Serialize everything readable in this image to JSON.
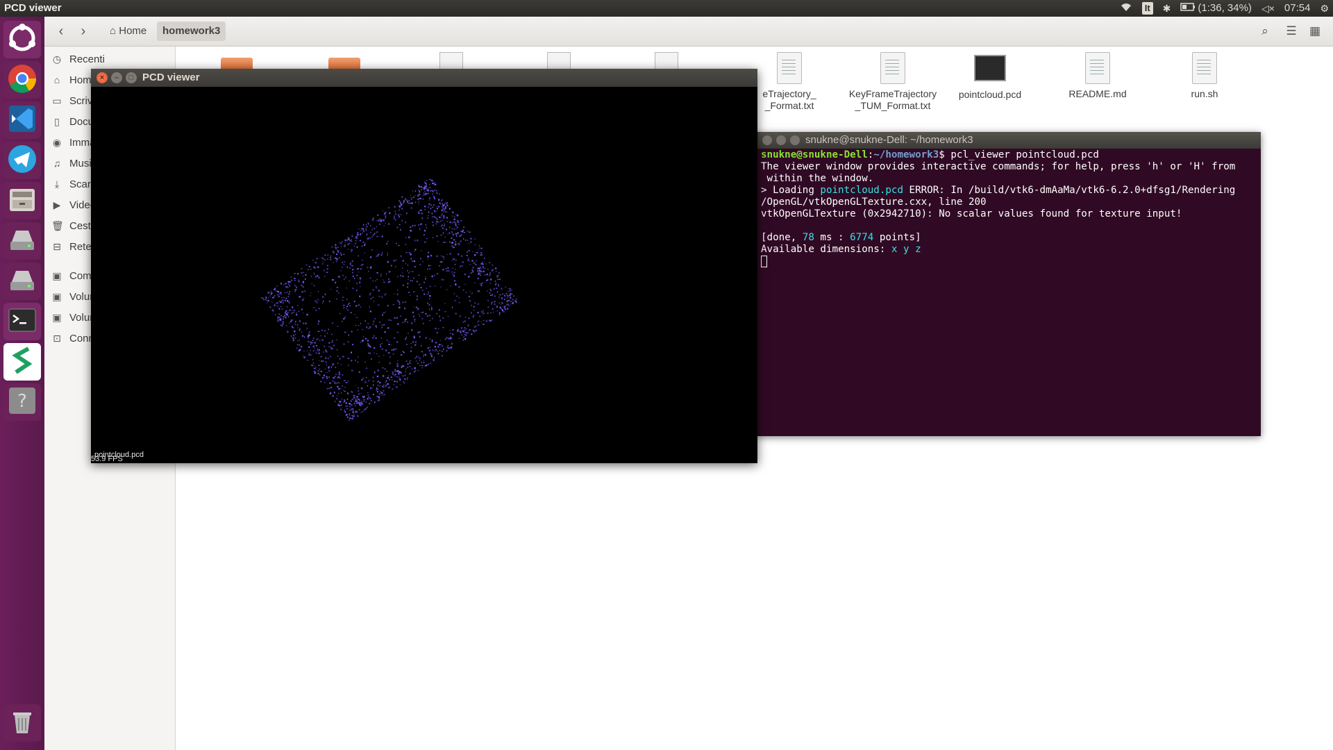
{
  "top_panel": {
    "app_title": "PCD viewer",
    "keyboard_layout": "It",
    "battery": "(1:36, 34%)",
    "clock": "07:54"
  },
  "launcher": {
    "items": [
      "ubuntu-dash",
      "chrome",
      "vscode",
      "telegram",
      "file-manager",
      "disk-drive",
      "disk-drive-2",
      "terminal",
      "app-s",
      "help",
      "trash"
    ]
  },
  "file_manager": {
    "breadcrumb": {
      "home": "Home",
      "current": "homework3"
    },
    "sidebar": [
      {
        "label": "Recenti",
        "icon": "clock-icon"
      },
      {
        "label": "Home",
        "icon": "home-icon"
      },
      {
        "label": "Scrivania",
        "icon": "folder-icon"
      },
      {
        "label": "Documenti",
        "icon": "document-icon"
      },
      {
        "label": "Immagini",
        "icon": "camera-icon"
      },
      {
        "label": "Musica",
        "icon": "music-icon"
      },
      {
        "label": "Scaricati",
        "icon": "download-icon"
      },
      {
        "label": "Video",
        "icon": "video-icon"
      },
      {
        "label": "Cestino",
        "icon": "trash-icon"
      },
      {
        "label": "Rete",
        "icon": "network-icon"
      },
      {
        "label": "Computer",
        "icon": "drive-icon"
      },
      {
        "label": "Volume",
        "icon": "drive-icon"
      },
      {
        "label": "Volume",
        "icon": "drive-icon"
      },
      {
        "label": "Connetti al server",
        "icon": "server-icon"
      }
    ],
    "files": [
      {
        "label": "eTrajectory_\n_Format.txt",
        "kind": "text"
      },
      {
        "label": "KeyFrameTrajectory\n_TUM_Format.txt",
        "kind": "text"
      },
      {
        "label": "pointcloud.pcd",
        "kind": "pcd"
      },
      {
        "label": "README.md",
        "kind": "text"
      },
      {
        "label": "run.sh",
        "kind": "script"
      }
    ]
  },
  "terminal": {
    "title": "snukne@snukne-Dell: ~/homework3",
    "prompt_user": "snukne@snukne-Dell",
    "prompt_path": "~/homework3",
    "command": "pcl_viewer pointcloud.pcd",
    "line_help_1": "The viewer window provides interactive commands; for help, press 'h' or 'H' from",
    "line_help_2": " within the window.",
    "loading_prefix": "> Loading ",
    "loading_file": "pointcloud.pcd",
    "loading_error": " ERROR: In /build/vtk6-dmAaMa/vtk6-6.2.0+dfsg1/Rendering",
    "line_error_2": "/OpenGL/vtkOpenGLTexture.cxx, line 200",
    "line_error_3": "vtkOpenGLTexture (0x2942710): No scalar values found for texture input!",
    "done_prefix": "[done, ",
    "done_ms": "78",
    "done_mid": " ms : ",
    "done_points": "6774",
    "done_suffix": " points]",
    "dims_prefix": "Available dimensions: ",
    "dims_values": "x y z"
  },
  "pcd_viewer": {
    "title": "PCD viewer",
    "fps_overlay": "53.9 FPS",
    "file_overlay": "pointcloud.pcd",
    "point_color": "#7a5cff"
  }
}
